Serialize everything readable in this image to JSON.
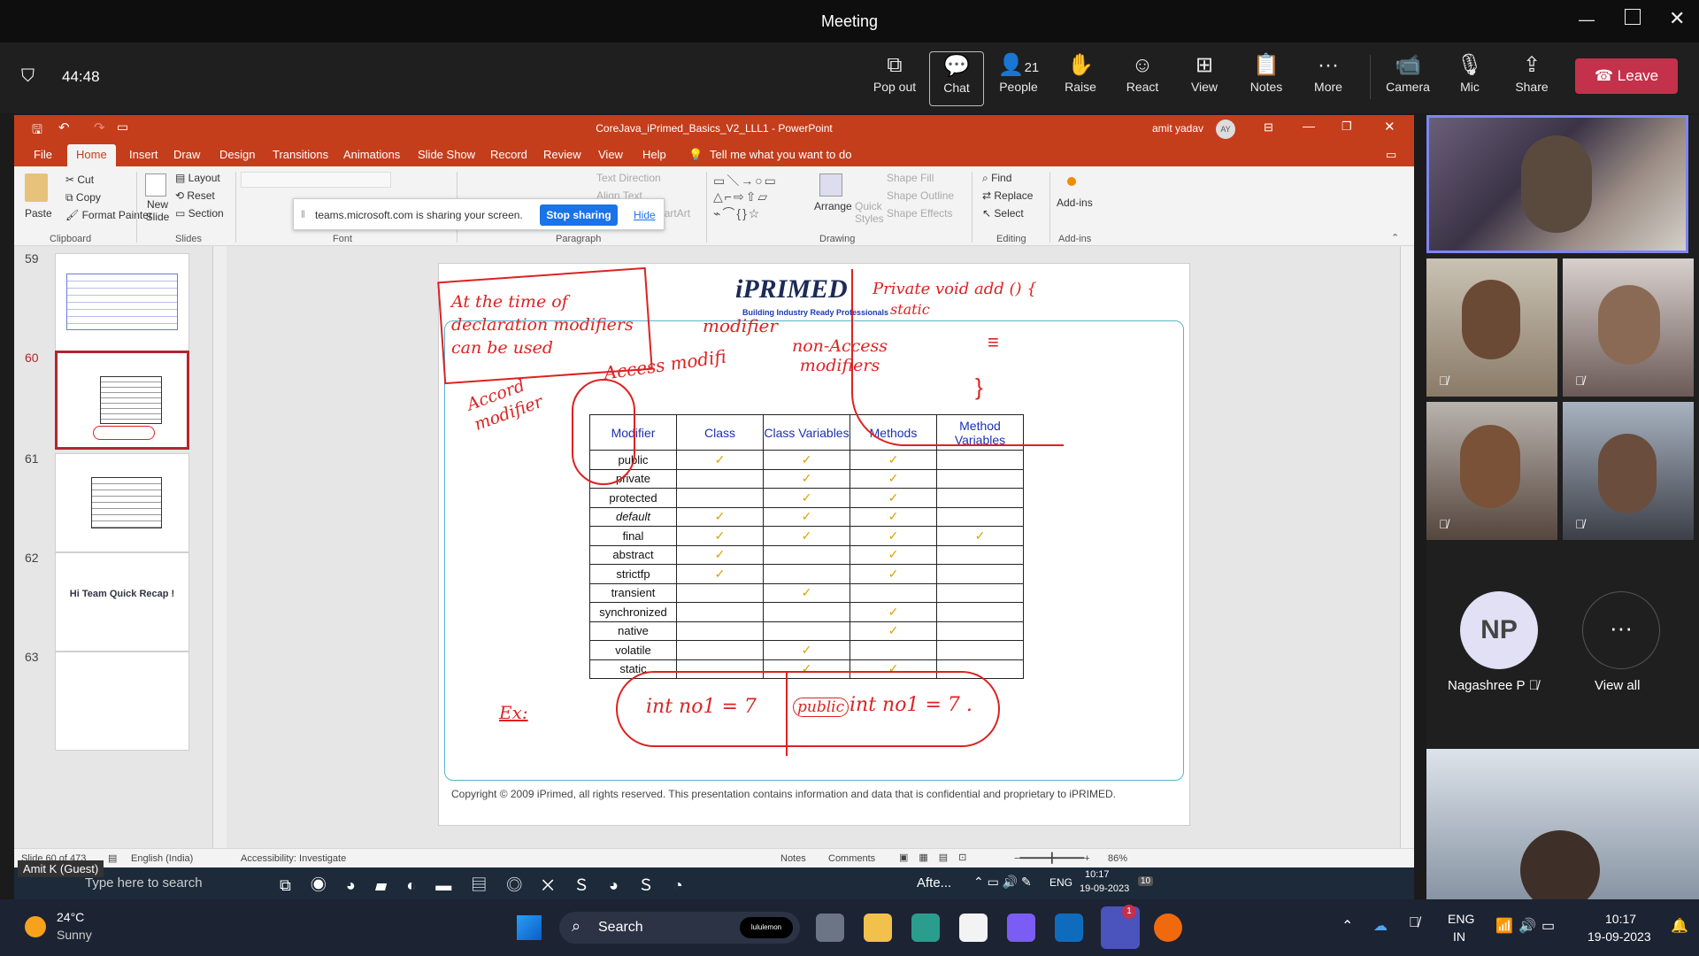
{
  "window": {
    "title": "Meeting"
  },
  "meeting": {
    "timer": "44:48",
    "buttons": [
      {
        "label": "Pop out",
        "icon": "pop-out-icon"
      },
      {
        "label": "Chat",
        "icon": "chat-icon"
      },
      {
        "label": "People",
        "icon": "people-icon",
        "count": "21"
      },
      {
        "label": "Raise",
        "icon": "raise-hand-icon"
      },
      {
        "label": "React",
        "icon": "react-icon"
      },
      {
        "label": "View",
        "icon": "view-icon"
      },
      {
        "label": "Notes",
        "icon": "notes-icon"
      },
      {
        "label": "More",
        "icon": "more-icon"
      },
      {
        "label": "Camera",
        "icon": "camera-icon"
      },
      {
        "label": "Mic",
        "icon": "mic-off-icon"
      },
      {
        "label": "Share",
        "icon": "share-icon"
      }
    ],
    "leave_label": "Leave"
  },
  "powerpoint": {
    "file_title": "CoreJava_iPrimed_Basics_V2_LLL1  -  PowerPoint",
    "user": "amit yadav",
    "user_initials": "AY",
    "tabs": [
      "File",
      "Home",
      "Insert",
      "Draw",
      "Design",
      "Transitions",
      "Animations",
      "Slide Show",
      "Record",
      "Review",
      "View",
      "Help"
    ],
    "tell_me": "Tell me what you want to do",
    "ribbon": {
      "paste": "Paste",
      "cut": "Cut",
      "copy": "Copy",
      "format_painter": "Format Painter",
      "new_slide": "New Slide",
      "layout": "Layout",
      "reset": "Reset",
      "section": "Section",
      "text_direction": "Text Direction",
      "align_text": "Align Text",
      "convert_smartart": "Convert to SmartArt",
      "arrange": "Arrange",
      "quick_styles": "Quick Styles",
      "shape_fill": "Shape Fill",
      "shape_outline": "Shape Outline",
      "shape_effects": "Shape Effects",
      "find": "Find",
      "replace": "Replace",
      "select": "Select",
      "addins": "Add-ins",
      "groups": {
        "clipboard": "Clipboard",
        "slides": "Slides",
        "font": "Font",
        "paragraph": "Paragraph",
        "drawing": "Drawing",
        "editing": "Editing",
        "addins": "Add-ins"
      }
    },
    "share_notice": {
      "text": "teams.microsoft.com is sharing your screen.",
      "stop": "Stop sharing",
      "hide": "Hide"
    },
    "thumbnails": [
      {
        "num": "59",
        "text": ""
      },
      {
        "num": "60",
        "text": ""
      },
      {
        "num": "61",
        "text": ""
      },
      {
        "num": "62",
        "text": "Hi Team Quick Recap !"
      },
      {
        "num": "63",
        "text": ""
      }
    ],
    "slide": {
      "brand": "iPRIMED",
      "tagline": "Building Industry Ready Professionals",
      "table_headers": [
        "Modifier",
        "Class",
        "Class Variables",
        "Methods",
        "Method Variables"
      ],
      "table_rows": [
        {
          "modifier": "public",
          "cells": [
            true,
            true,
            true,
            false
          ]
        },
        {
          "modifier": "private",
          "cells": [
            false,
            true,
            true,
            false
          ]
        },
        {
          "modifier": "protected",
          "cells": [
            false,
            true,
            true,
            false
          ]
        },
        {
          "modifier": "default",
          "cells": [
            true,
            true,
            true,
            false
          ]
        },
        {
          "modifier": "final",
          "cells": [
            true,
            true,
            true,
            true
          ]
        },
        {
          "modifier": "abstract",
          "cells": [
            true,
            false,
            true,
            false
          ]
        },
        {
          "modifier": "strictfp",
          "cells": [
            true,
            false,
            true,
            false
          ]
        },
        {
          "modifier": "transient",
          "cells": [
            false,
            true,
            false,
            false
          ]
        },
        {
          "modifier": "synchronized",
          "cells": [
            false,
            false,
            true,
            false
          ]
        },
        {
          "modifier": "native",
          "cells": [
            false,
            false,
            true,
            false
          ]
        },
        {
          "modifier": "volatile",
          "cells": [
            false,
            true,
            false,
            false
          ]
        },
        {
          "modifier": "static",
          "cells": [
            false,
            true,
            true,
            false
          ]
        }
      ],
      "annotations": {
        "top_left": "At the time of declaration modifiers can be used",
        "modifier": "modifier",
        "access": "Access modifi",
        "non_access": "non-Access modifiers",
        "accord": "Accord modifier",
        "private_void": "Private void add () {",
        "static": "static",
        "ex": "Ex:",
        "ex_left": "int no1 = 7",
        "ex_public": "public",
        "ex_right": "int no1 = 7 ."
      },
      "copyright": "Copyright © 2009 iPrimed, all rights reserved. This presentation contains information  and data  that is confidential and proprietary to iPRIMED."
    },
    "status": {
      "slide": "Slide 60 of 473",
      "language": "English (India)",
      "accessibility": "Accessibility: Investigate",
      "notes": "Notes",
      "comments": "Comments",
      "zoom": "86%"
    },
    "inner_taskbar": {
      "search": "Type here to search",
      "weather": "Afte...",
      "lang": "ENG",
      "time": "10:17",
      "date": "19-09-2023",
      "badge": "10",
      "presenter": "Amit K (Guest)"
    }
  },
  "participants": {
    "np_initials": "NP",
    "np_name": "Nagashree P",
    "view_all": "View all"
  },
  "taskbar": {
    "temp": "24°C",
    "weather": "Sunny",
    "search": "Search",
    "lang1": "ENG",
    "lang2": "IN",
    "time": "10:17",
    "date": "19-09-2023",
    "teams_badge": "1",
    "store_label": "lululemon"
  }
}
